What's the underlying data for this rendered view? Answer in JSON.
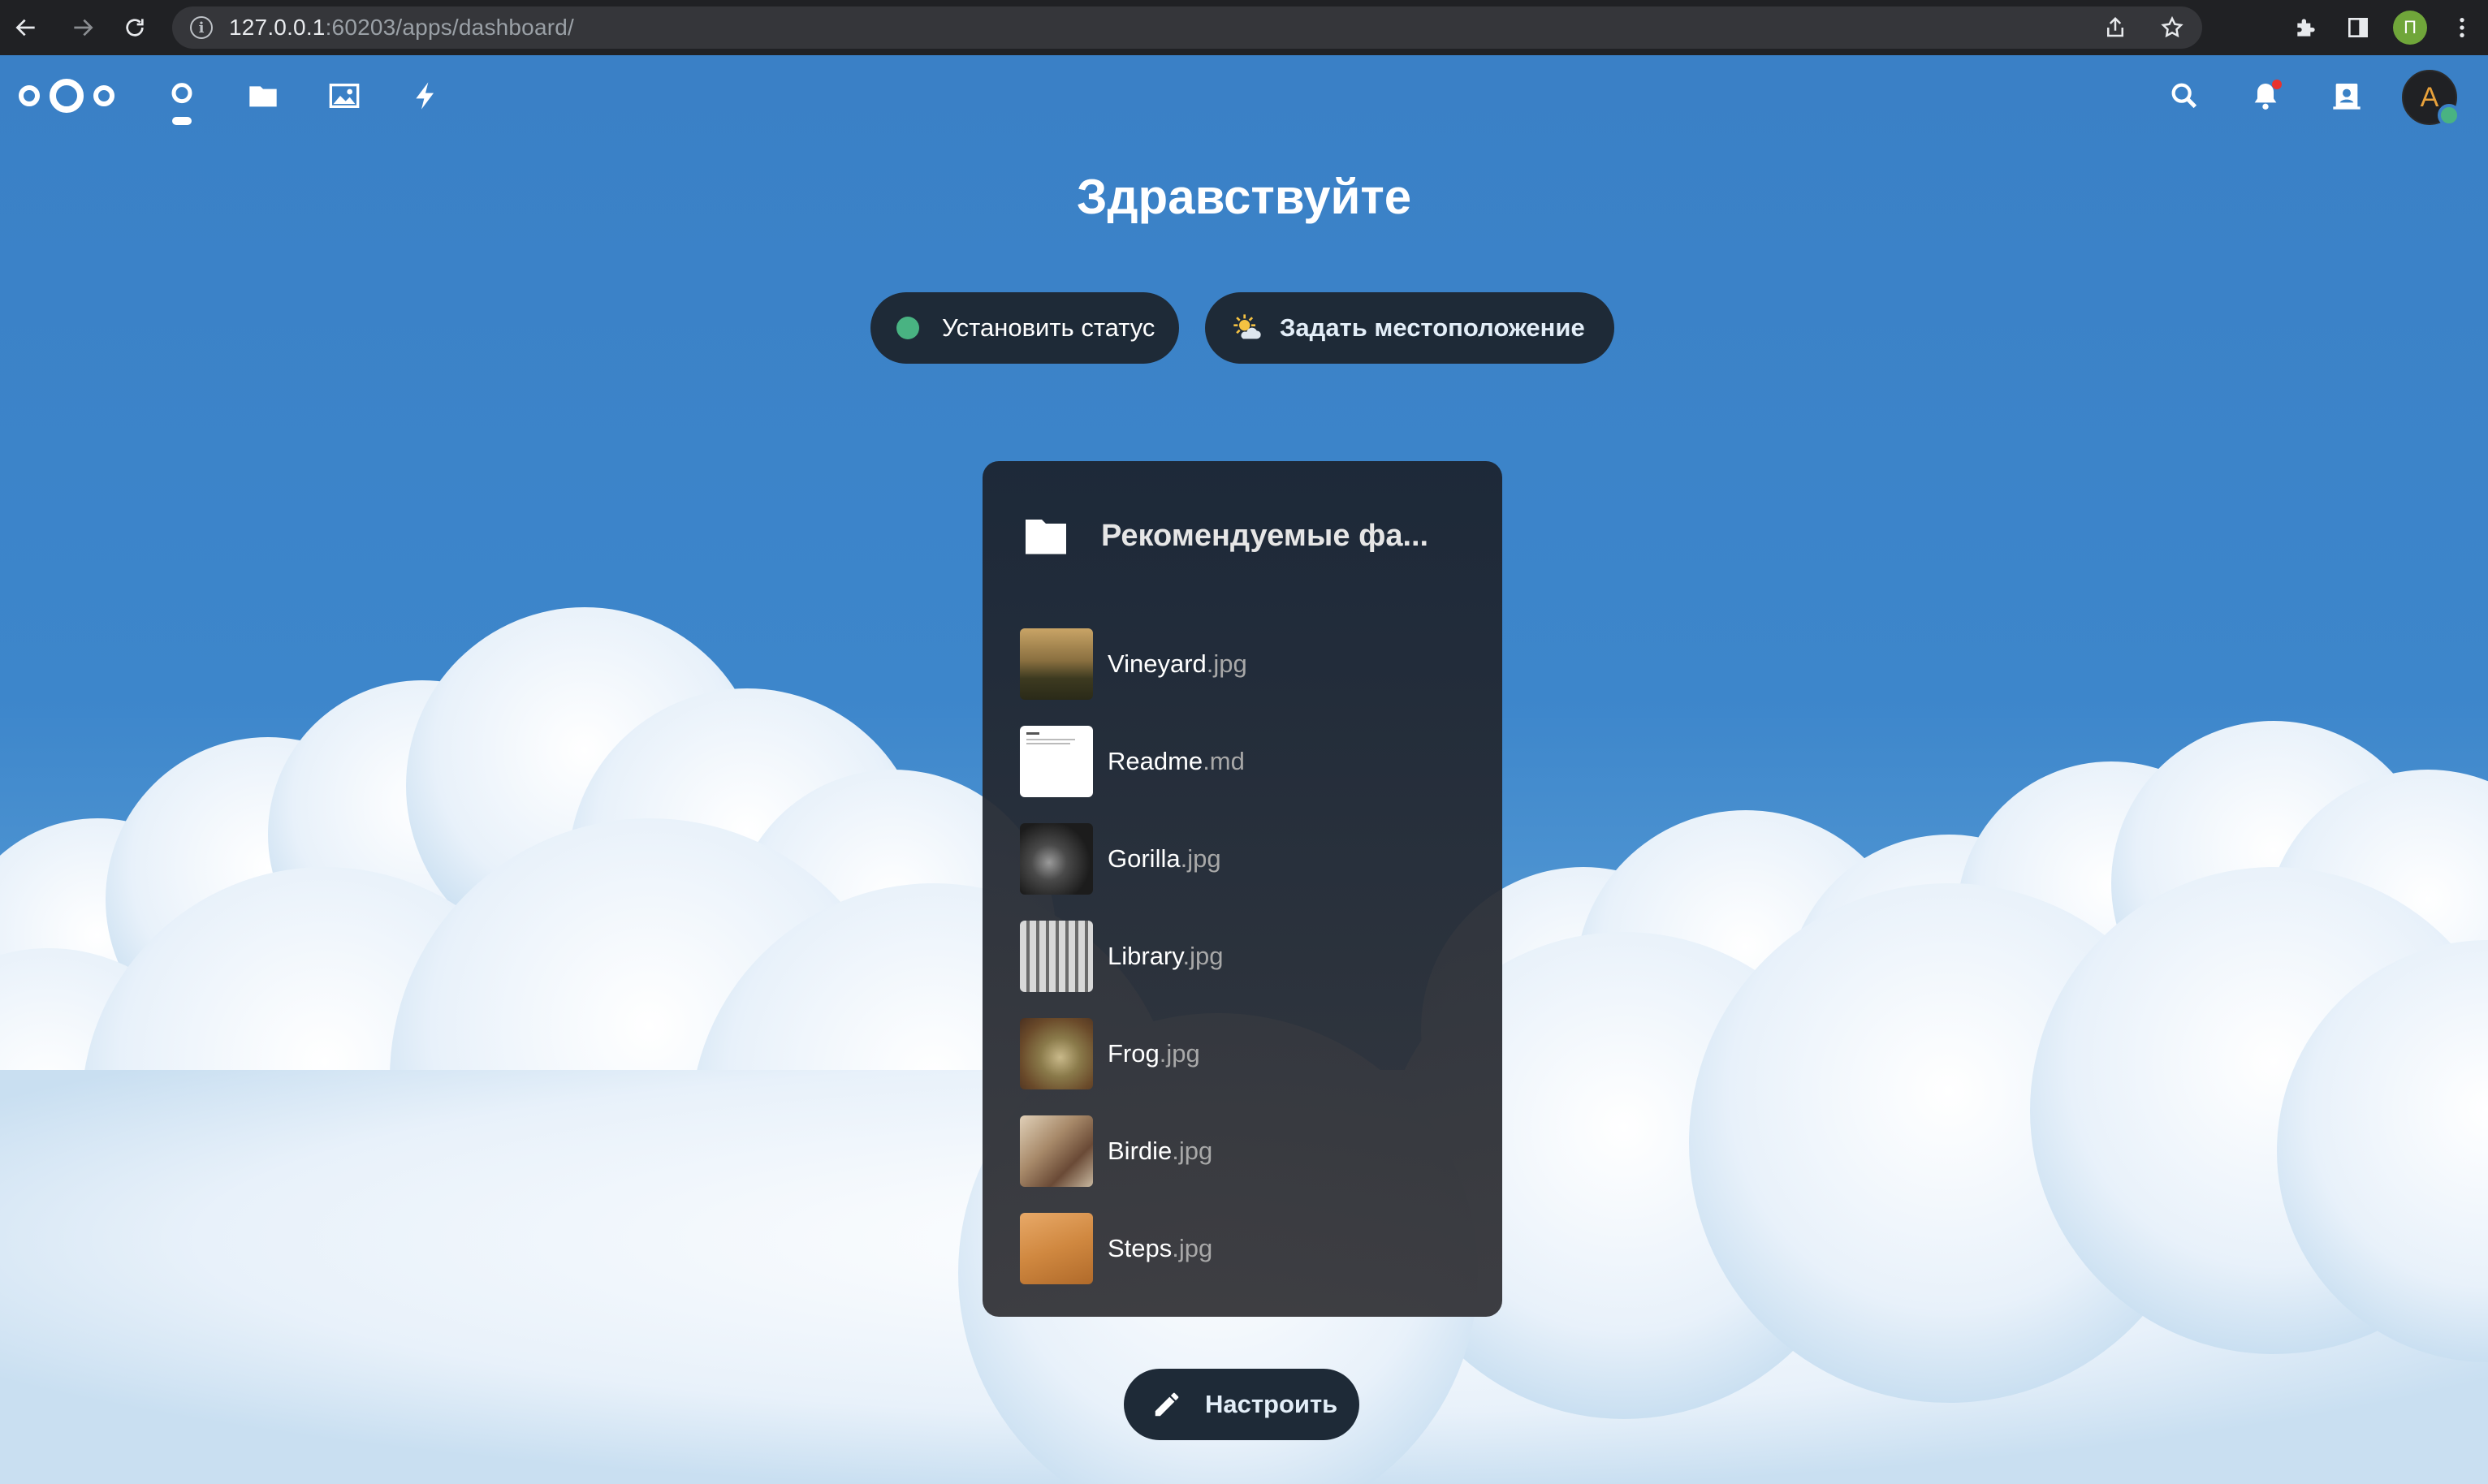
{
  "browser": {
    "url_host": "127.0.0.1",
    "url_path": ":60203/apps/dashboard/",
    "profile_initial": "П",
    "icons": [
      "back-icon",
      "forward-icon",
      "reload-icon",
      "info-icon",
      "share-icon",
      "star-icon",
      "extensions-icon",
      "side-panel-icon",
      "menu-icon"
    ]
  },
  "header": {
    "apps": [
      "dashboard-icon",
      "files-icon",
      "photos-icon",
      "activity-icon"
    ],
    "right_icons": [
      "search-icon",
      "notifications-icon",
      "contacts-icon"
    ],
    "avatar_initial": "A"
  },
  "dashboard": {
    "greeting": "Здравствуйте",
    "status_button": "Установить статус",
    "weather_button": "Задать местоположение",
    "customize_button": "Настроить"
  },
  "widget": {
    "title": "Рекомендуемые фа...",
    "files": [
      {
        "name": "Vineyard",
        "ext": ".jpg"
      },
      {
        "name": "Readme",
        "ext": ".md"
      },
      {
        "name": "Gorilla",
        "ext": ".jpg"
      },
      {
        "name": "Library",
        "ext": ".jpg"
      },
      {
        "name": "Frog",
        "ext": ".jpg"
      },
      {
        "name": "Birdie",
        "ext": ".jpg"
      },
      {
        "name": "Steps",
        "ext": ".jpg"
      }
    ]
  },
  "colors": {
    "nextcloud_blue": "#3a82c6",
    "pill_bg": "#1e2a37",
    "online_green": "#49b382"
  }
}
